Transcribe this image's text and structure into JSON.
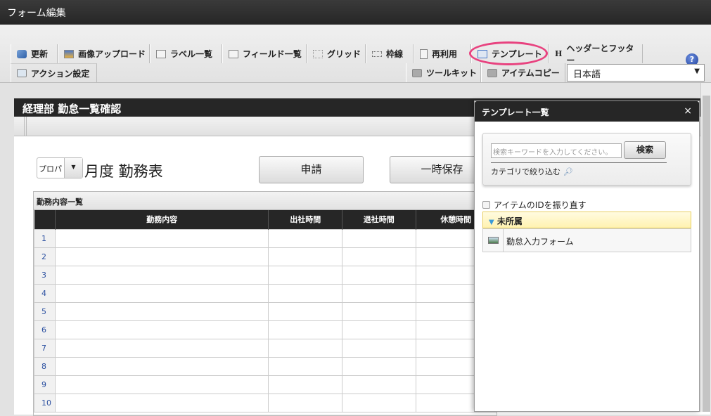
{
  "window": {
    "title": "フォーム編集"
  },
  "toolbar": {
    "help": "?",
    "row1": [
      "更新",
      "画像アップロード",
      "ラベル一覧",
      "フィールド一覧",
      "グリッド",
      "枠線",
      "再利用",
      "テンプレート",
      "ヘッダーとフッター"
    ],
    "row2": [
      "アクション設定",
      "ツールキット",
      "アイテムコピー"
    ],
    "language": "日本語"
  },
  "form": {
    "title": "経理部 勤怠一覧確認",
    "month_select": "プロパ",
    "heading": "月度 勤務表",
    "apply_button": "申請",
    "save_button": "一時保存",
    "table": {
      "caption": "勤務内容一覧",
      "columns": [
        "勤務内容",
        "出社時間",
        "退社時間",
        "休憩時間"
      ],
      "rows": [
        "1",
        "2",
        "3",
        "4",
        "5",
        "6",
        "7",
        "8",
        "9",
        "10"
      ]
    }
  },
  "template_panel": {
    "title": "テンプレート一覧",
    "close": "×",
    "search_placeholder": "検索キーワードを入力してください。",
    "search_button": "検索",
    "category_filter": "カテゴリで絞り込む",
    "renumber_ids": "アイテムのIDを振り直す",
    "group": "未所属",
    "items": [
      "勤怠入力フォーム"
    ]
  }
}
